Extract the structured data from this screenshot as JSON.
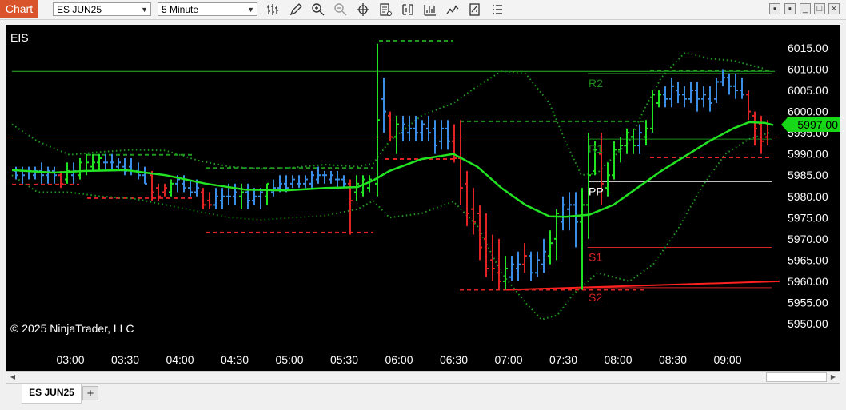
{
  "app": {
    "title": "Chart"
  },
  "toolbar": {
    "instrument": "ES JUN25",
    "interval": "5 Minute",
    "icons": [
      "bar-type-icon",
      "draw-icon",
      "zoom-in-icon",
      "zoom-out-icon",
      "crosshair-icon",
      "properties-icon",
      "data-box-icon",
      "indicators-icon",
      "strategies-icon",
      "chart-trader-icon",
      "more-icon"
    ]
  },
  "window": {
    "minimize": "_",
    "maximize": "□",
    "close": "×"
  },
  "chart": {
    "symbol_label": "EIS",
    "copyright": "© 2025 NinjaTrader, LLC",
    "last_price_label": "5997.00",
    "colors": {
      "background": "#000000",
      "up": "#22e322",
      "down": "#e02323",
      "neutral": "#3a8ee6",
      "ma": "#22e322",
      "bands": "#1f9a1f",
      "axis_text": "#ffffff",
      "r2_text": "#1d8a1d",
      "s_text": "#d62424",
      "pp_text": "#ffffff"
    },
    "level_labels": {
      "r2": "R2",
      "r1": "R1",
      "pp": "PP",
      "s1": "S1",
      "s2": "S2"
    }
  },
  "tabs": {
    "active": "ES JUN25",
    "add": "+"
  },
  "chart_data": {
    "type": "candlestick",
    "x": [
      "03:00",
      "03:30",
      "04:00",
      "04:30",
      "05:00",
      "05:30",
      "06:00",
      "06:30",
      "07:00",
      "07:30",
      "08:00",
      "08:30",
      "09:00"
    ],
    "y_ticks": [
      6015.0,
      6010.0,
      6005.0,
      6000.0,
      5995.0,
      5990.0,
      5985.0,
      5980.0,
      5975.0,
      5970.0,
      5965.0,
      5960.0,
      5955.0,
      5950.0
    ],
    "ylim": [
      5948.5,
      6017.5
    ],
    "last_price": 5997.0,
    "levels": {
      "r2": 6009.0,
      "r1": 5993.5,
      "pp": 5983.5,
      "s1": 5968.0,
      "s2": 5958.5,
      "horizontal_green": 6009.5,
      "horizontal_red": 5994.0
    }
  }
}
